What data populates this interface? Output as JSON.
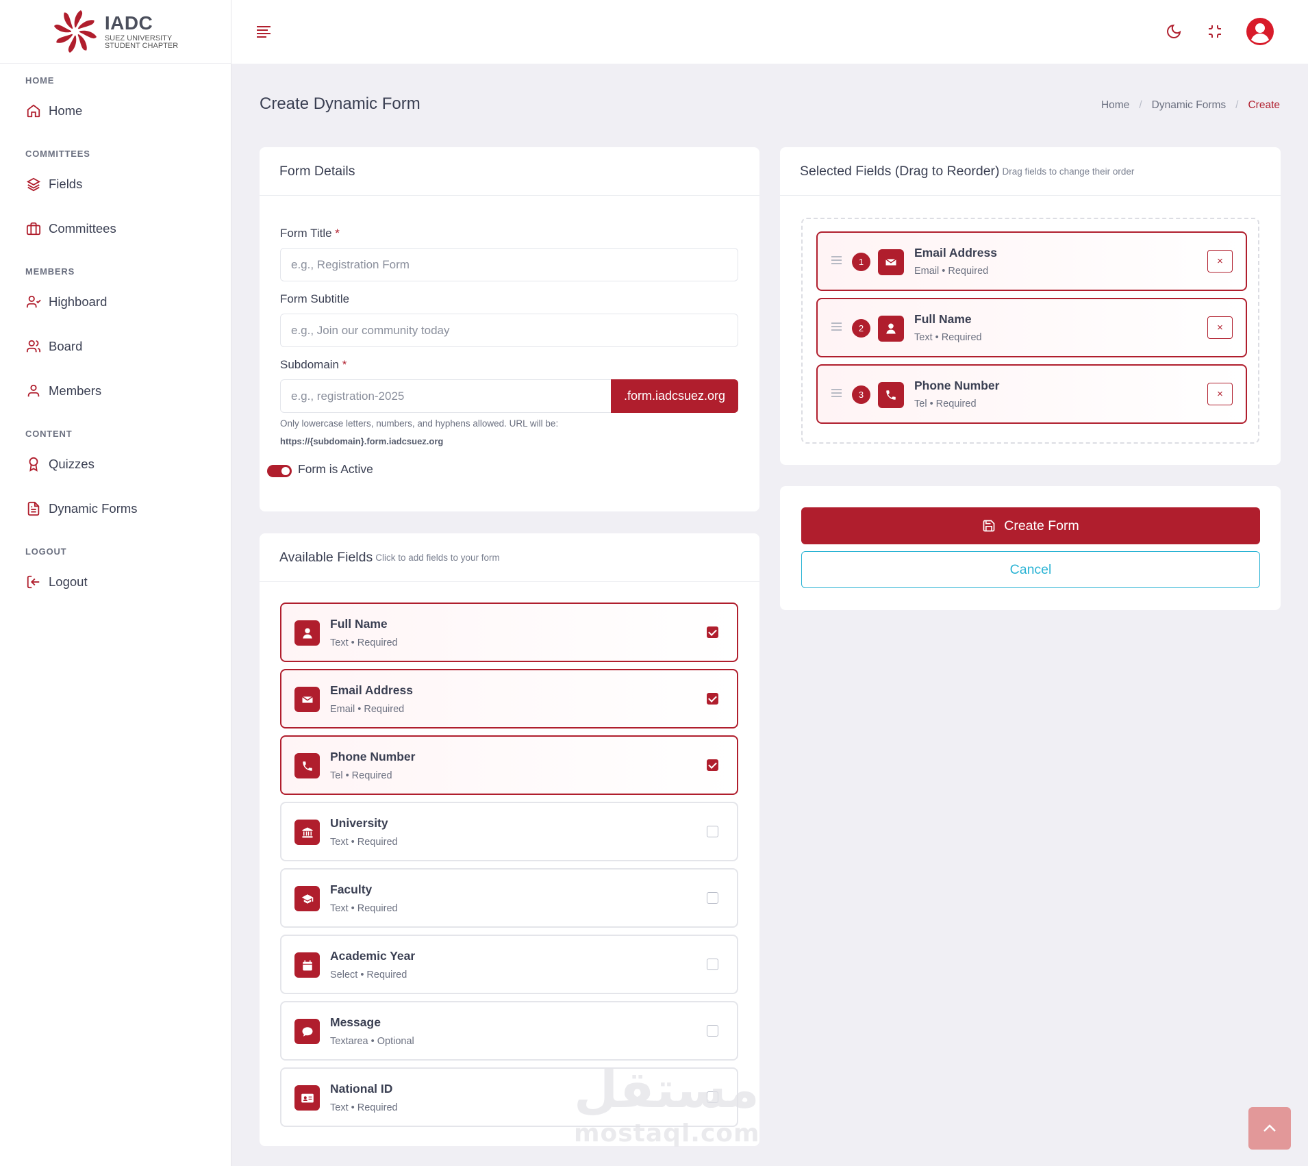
{
  "brand": {
    "title": "IADC",
    "line1": "SUEZ UNIVERSITY",
    "line2": "STUDENT CHAPTER"
  },
  "sidebar": {
    "sections": [
      {
        "title": "HOME",
        "items": [
          {
            "label": "Home",
            "icon": "home-icon"
          }
        ]
      },
      {
        "title": "COMMITTEES",
        "items": [
          {
            "label": "Fields",
            "icon": "layers-icon"
          },
          {
            "label": "Committees",
            "icon": "briefcase-icon"
          }
        ]
      },
      {
        "title": "MEMBERS",
        "items": [
          {
            "label": "Highboard",
            "icon": "user-check-icon"
          },
          {
            "label": "Board",
            "icon": "users-icon"
          },
          {
            "label": "Members",
            "icon": "user-icon"
          }
        ]
      },
      {
        "title": "CONTENT",
        "items": [
          {
            "label": "Quizzes",
            "icon": "award-icon"
          },
          {
            "label": "Dynamic Forms",
            "icon": "file-text-icon"
          }
        ]
      },
      {
        "title": "LOGOUT",
        "items": [
          {
            "label": "Logout",
            "icon": "logout-icon"
          }
        ]
      }
    ]
  },
  "page": {
    "title": "Create Dynamic Form",
    "breadcrumb": [
      "Home",
      "Dynamic Forms",
      "Create"
    ]
  },
  "form_details": {
    "title": "Form Details",
    "form_title_label": "Form Title",
    "form_title_placeholder": "e.g., Registration Form",
    "subtitle_label": "Form Subtitle",
    "subtitle_placeholder": "e.g., Join our community today",
    "subdomain_label": "Subdomain",
    "subdomain_placeholder": "e.g., registration-2025",
    "subdomain_suffix": ".form.iadcsuez.org",
    "help_line1": "Only lowercase letters, numbers, and hyphens allowed. URL will be:",
    "help_line2": "https://{subdomain}.form.iadcsuez.org",
    "active_label": "Form is Active",
    "required_mark": "*"
  },
  "available": {
    "title": "Available Fields",
    "hint": "Click to add fields to your form",
    "fields": [
      {
        "name": "Full Name",
        "meta": "Text • Required",
        "icon": "user-icon",
        "checked": true
      },
      {
        "name": "Email Address",
        "meta": "Email • Required",
        "icon": "envelope-icon",
        "checked": true
      },
      {
        "name": "Phone Number",
        "meta": "Tel • Required",
        "icon": "phone-icon",
        "checked": true
      },
      {
        "name": "University",
        "meta": "Text • Required",
        "icon": "university-icon",
        "checked": false
      },
      {
        "name": "Faculty",
        "meta": "Text • Required",
        "icon": "graduation-cap-icon",
        "checked": false
      },
      {
        "name": "Academic Year",
        "meta": "Select • Required",
        "icon": "calendar-icon",
        "checked": false
      },
      {
        "name": "Message",
        "meta": "Textarea • Optional",
        "icon": "comment-icon",
        "checked": false
      },
      {
        "name": "National ID",
        "meta": "Text • Required",
        "icon": "id-card-icon",
        "checked": false
      }
    ]
  },
  "selected": {
    "title": "Selected Fields (Drag to Reorder)",
    "hint": "Drag fields to change their order",
    "fields": [
      {
        "num": "1",
        "name": "Email Address",
        "meta": "Email • Required",
        "icon": "envelope-icon"
      },
      {
        "num": "2",
        "name": "Full Name",
        "meta": "Text • Required",
        "icon": "user-icon"
      },
      {
        "num": "3",
        "name": "Phone Number",
        "meta": "Tel • Required",
        "icon": "phone-icon"
      }
    ],
    "remove_label": "×"
  },
  "actions": {
    "create_label": "Create Form",
    "cancel_label": "Cancel"
  },
  "watermark": {
    "arabic": "مستقل",
    "latin": "mostaql.com"
  },
  "colors": {
    "accent": "#b01e2d",
    "info": "#2ab3d4",
    "background": "#f0eff4"
  }
}
